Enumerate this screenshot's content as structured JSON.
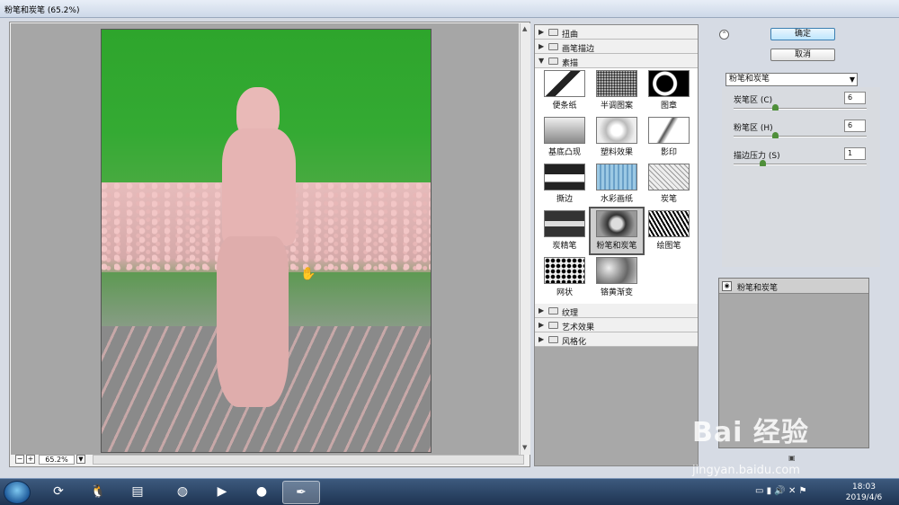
{
  "window": {
    "title": "粉笔和炭笔 (65.2%)"
  },
  "preview": {
    "zoom_minus": "−",
    "zoom_plus": "+",
    "zoom_value": "65.2%",
    "zoom_dropdown": "▼"
  },
  "gallery": {
    "categories_top": [
      {
        "label": "扭曲",
        "expanded": false
      },
      {
        "label": "画笔描边",
        "expanded": false
      },
      {
        "label": "素描",
        "expanded": true
      }
    ],
    "categories_bottom": [
      {
        "label": "纹理",
        "expanded": false
      },
      {
        "label": "艺术效果",
        "expanded": false
      },
      {
        "label": "风格化",
        "expanded": false
      }
    ],
    "filters": [
      {
        "label": "便条纸",
        "icon": "note-paper-thumb"
      },
      {
        "label": "半调图案",
        "icon": "halftone-thumb"
      },
      {
        "label": "图章",
        "icon": "stamp-thumb"
      },
      {
        "label": "基底凸现",
        "icon": "bas-relief-thumb"
      },
      {
        "label": "塑料效果",
        "icon": "plaster-thumb"
      },
      {
        "label": "影印",
        "icon": "photocopy-thumb"
      },
      {
        "label": "撕边",
        "icon": "torn-edges-thumb"
      },
      {
        "label": "水彩画纸",
        "icon": "water-paper-thumb"
      },
      {
        "label": "炭笔",
        "icon": "charcoal-thumb"
      },
      {
        "label": "炭精笔",
        "icon": "conte-crayon-thumb"
      },
      {
        "label": "粉笔和炭笔",
        "icon": "chalk-charcoal-thumb",
        "selected": true
      },
      {
        "label": "绘图笔",
        "icon": "graphic-pen-thumb"
      },
      {
        "label": "网状",
        "icon": "reticulation-thumb"
      },
      {
        "label": "铬黄渐变",
        "icon": "chrome-thumb"
      }
    ]
  },
  "panel": {
    "collapse_glyph": "⌃",
    "ok_label": "确定",
    "cancel_label": "取消",
    "filter_select": "粉笔和炭笔",
    "params": [
      {
        "label": "炭笔区 (C)",
        "value": "6",
        "fraction": 0.3
      },
      {
        "label": "粉笔区 (H)",
        "value": "6",
        "fraction": 0.3
      },
      {
        "label": "描边压力 (S)",
        "value": "1",
        "fraction": 0.2
      }
    ],
    "layer_name": "粉笔和炭笔"
  },
  "watermark": {
    "brand": "Bai 经验",
    "url": "jingyan.baidu.com"
  },
  "taskbar": {
    "clock_time": "18:03",
    "clock_date": "2019/4/6"
  }
}
